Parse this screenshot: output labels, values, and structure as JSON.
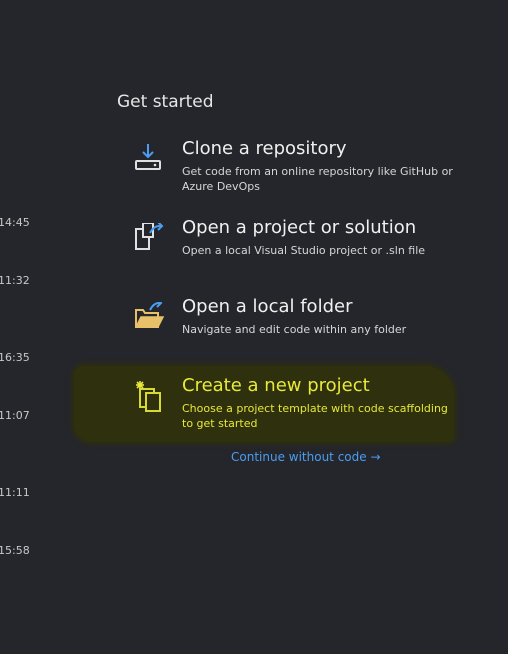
{
  "recent": {
    "times": [
      "14:45",
      "11:32",
      "16:35",
      "11:07",
      "11:11",
      "15:58"
    ]
  },
  "get_started": {
    "title": "Get started",
    "actions": [
      {
        "title": "Clone a repository",
        "description": "Get code from an online repository like GitHub or Azure DevOps",
        "icon": "clone-repository-icon"
      },
      {
        "title": "Open a project or solution",
        "description": "Open a local Visual Studio project or .sln file",
        "icon": "open-project-icon"
      },
      {
        "title": "Open a local folder",
        "description": "Navigate and edit code within any folder",
        "icon": "open-folder-icon"
      },
      {
        "title": "Create a new project",
        "description": "Choose a project template with code scaffolding to get started",
        "icon": "new-project-icon"
      }
    ],
    "continue_link": "Continue without code →"
  },
  "colors": {
    "background": "#25262b",
    "highlight": "#2f300d",
    "highlight_text": "#e8ea3a",
    "link": "#4a9df0",
    "icon_blue": "#4a9df0",
    "icon_folder": "#e8c06a"
  }
}
